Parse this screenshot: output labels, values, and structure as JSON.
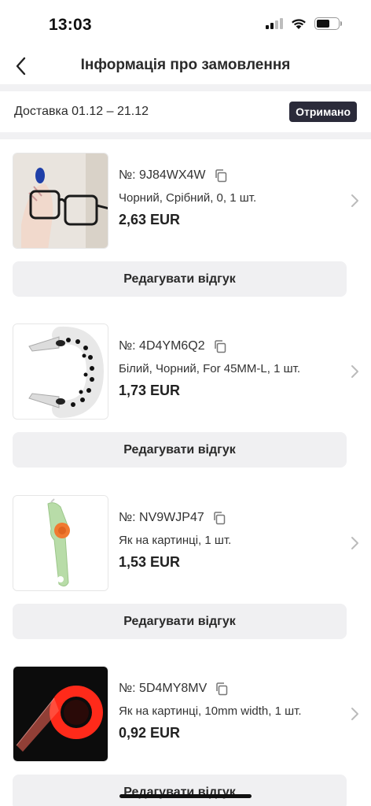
{
  "status_bar": {
    "time": "13:03"
  },
  "header": {
    "title": "Інформація про замовлення"
  },
  "delivery": {
    "text": "Доставка 01.12 – 21.12",
    "status": "Отримано"
  },
  "items": [
    {
      "sku": "№: 9J84WX4W",
      "variant": "Чорний, Срібний, 0, 1 шт.",
      "price": "2,63 EUR",
      "review_label": "Редагувати відгук",
      "image": "eyeglasses-photo"
    },
    {
      "sku": "№: 4D4YM6Q2",
      "variant": "Білий, Чорний, For 45MM-L, 1 шт.",
      "price": "1,73 EUR",
      "review_label": "Редагувати відгук",
      "image": "watch-band-photo"
    },
    {
      "sku": "№: NV9WJP47",
      "variant": "Як на картинці, 1 шт.",
      "price": "1,53 EUR",
      "review_label": "Редагувати відгук",
      "image": "seam-ripper-photo"
    },
    {
      "sku": "№: 5D4MY8MV",
      "variant": "Як на картинці, 10mm width, 1 шт.",
      "price": "0,92 EUR",
      "review_label": "Редагувати відгук",
      "image": "red-tape-photo"
    }
  ],
  "colors": {
    "badge_bg": "#2b2b3a",
    "button_bg": "#f0f0f2",
    "divider": "#f1f1f3"
  }
}
